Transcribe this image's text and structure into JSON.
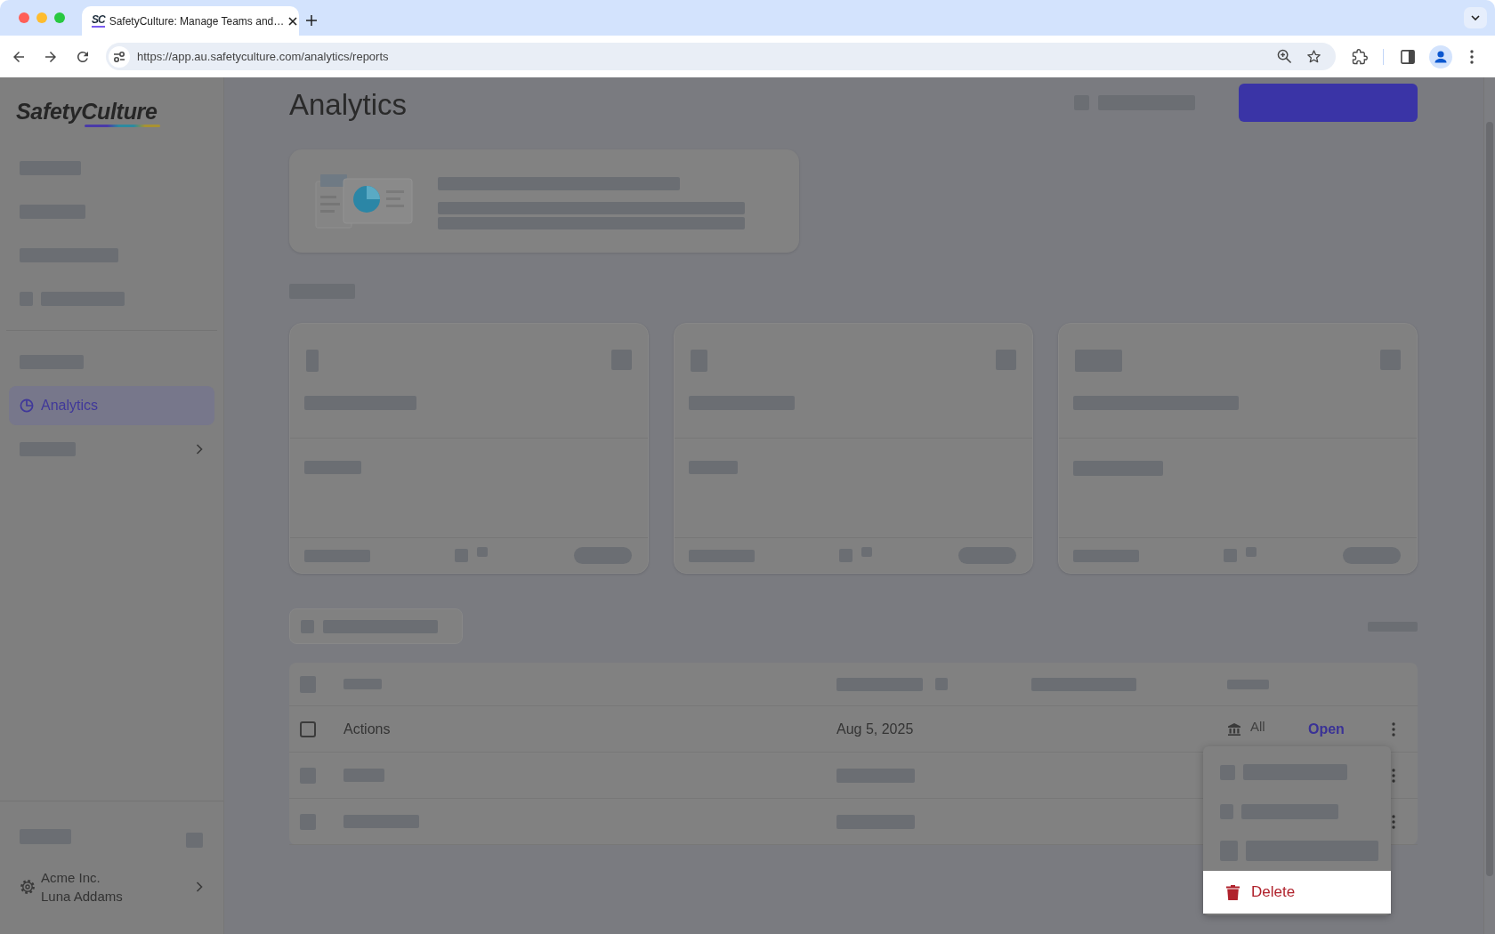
{
  "browser": {
    "tabs": [
      {
        "icon_text": "SC",
        "title": "SafetyCulture: Manage Teams and…",
        "selected": true
      }
    ],
    "url": "https://app.au.safetyculture.com/analytics/reports"
  },
  "sidebar": {
    "logo": "SafetyCulture",
    "sections": [
      {
        "items": [
          {
            "kind": "redacted",
            "selected": false,
            "expandable": false
          },
          {
            "kind": "redacted",
            "selected": false,
            "expandable": false
          },
          {
            "kind": "redacted",
            "selected": false,
            "expandable": false
          },
          {
            "kind": "redacted",
            "selected": false,
            "expandable": false
          }
        ]
      },
      {
        "items": [
          {
            "kind": "redacted",
            "selected": false,
            "expandable": false
          },
          {
            "kind": "link",
            "label": "Analytics",
            "selected": true,
            "expandable": false
          },
          {
            "kind": "redacted",
            "selected": false,
            "expandable": true
          }
        ]
      }
    ],
    "account": {
      "organization": "Acme Inc.",
      "user": "Luna Addams",
      "expandable": true
    }
  },
  "page": {
    "title": "Analytics"
  },
  "table": {
    "rows": [
      {
        "kind": "report",
        "checked": false,
        "name": "Actions",
        "date": "Aug 5, 2025",
        "access": "All",
        "action": "Open"
      },
      {
        "kind": "redacted"
      },
      {
        "kind": "redacted"
      }
    ]
  },
  "row_menu": {
    "items": [
      {
        "kind": "redacted",
        "selected": false
      },
      {
        "kind": "redacted",
        "selected": false
      },
      {
        "kind": "redacted",
        "selected": false
      },
      {
        "kind": "delete",
        "label": "Delete",
        "selected": true
      }
    ]
  }
}
